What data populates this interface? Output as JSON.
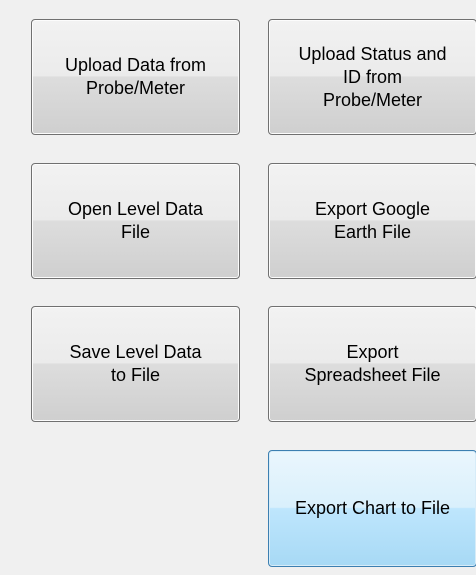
{
  "buttons": {
    "upload_data": "Upload Data from\nProbe/Meter",
    "upload_status_id": "Upload Status and\nID from\nProbe/Meter",
    "open_level_data": "Open Level Data\nFile",
    "export_google_earth": "Export Google\nEarth File",
    "save_level_data": "Save Level Data\nto File",
    "export_spreadsheet": "Export\nSpreadsheet File",
    "export_chart": "Export Chart to File"
  },
  "colors": {
    "background": "#f0f0f0",
    "button_border": "#707070",
    "focused_border": "#3c7fb1"
  }
}
